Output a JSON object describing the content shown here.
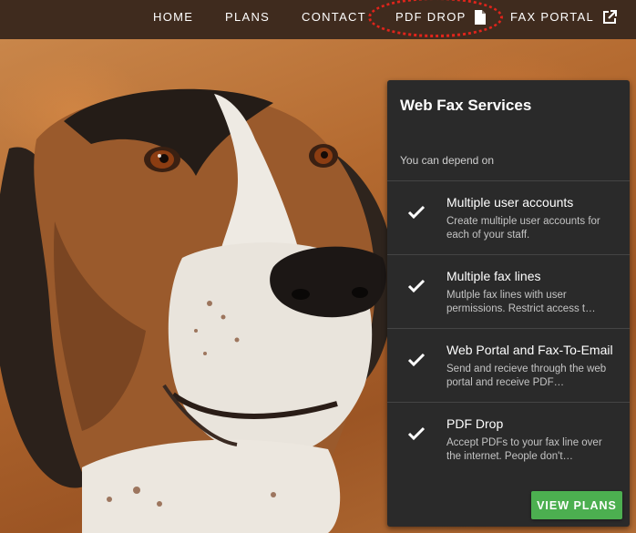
{
  "nav": {
    "items": [
      {
        "label": "HOME"
      },
      {
        "label": "PLANS"
      },
      {
        "label": "CONTACT"
      },
      {
        "label": "PDF DROP",
        "icon": "document-icon"
      },
      {
        "label": "FAX PORTAL",
        "icon": "external-link-icon"
      }
    ],
    "highlight_color": "#e0241b"
  },
  "card": {
    "title": "Web Fax Services",
    "subtitle": "You can depend on",
    "features": [
      {
        "title": "Multiple user accounts",
        "description": "Create multiple user accounts for each of your staff."
      },
      {
        "title": "Multiple fax lines",
        "description": "Mutlple fax lines with user permissions. Restrict access t…"
      },
      {
        "title": "Web Portal and Fax-To-Email",
        "description": "Send and recieve through the web portal and receive PDF…"
      },
      {
        "title": "PDF Drop",
        "description": "Accept PDFs to your fax line over the internet. People don't…"
      }
    ],
    "button_label": "VIEW PLANS",
    "button_color": "#4caf50"
  },
  "colors": {
    "navbar": "#3f2b1e",
    "card_bg": "#2a2a2a"
  }
}
